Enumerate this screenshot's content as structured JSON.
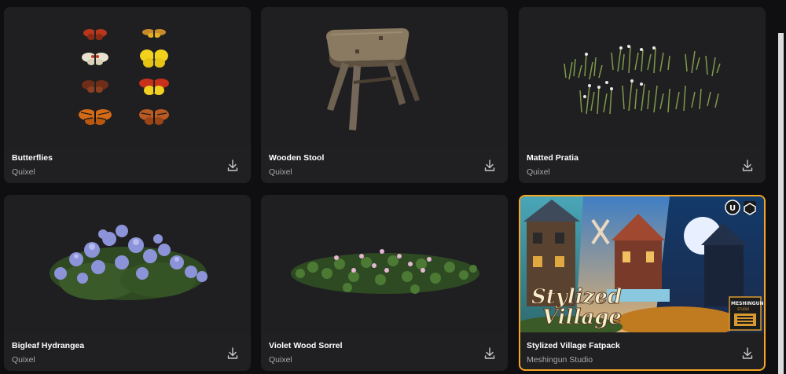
{
  "assets": [
    {
      "title": "Butterflies",
      "creator": "Quixel",
      "thumbnail": "butterflies-thumbnail"
    },
    {
      "title": "Wooden Stool",
      "creator": "Quixel",
      "thumbnail": "wooden-stool-thumbnail"
    },
    {
      "title": "Matted Pratia",
      "creator": "Quixel",
      "thumbnail": "matted-pratia-thumbnail"
    },
    {
      "title": "Bigleaf Hydrangea",
      "creator": "Quixel",
      "thumbnail": "bigleaf-hydrangea-thumbnail"
    },
    {
      "title": "Violet Wood Sorrel",
      "creator": "Quixel",
      "thumbnail": "violet-wood-sorrel-thumbnail"
    },
    {
      "title": "Stylized Village Fatpack",
      "creator": "Meshingun Studio",
      "thumbnail": "stylized-village-thumbnail",
      "thumb_title_line1": "Stylized",
      "thumb_title_line2": "Village",
      "brand_badge": "MESHINGUN",
      "brand_sub": "STUDIO"
    }
  ],
  "icons": {
    "download": "download-icon",
    "engine_a": "unreal-engine-icon",
    "engine_b": "unity-icon"
  },
  "colors": {
    "background": "#0f0f11",
    "card": "#202022",
    "highlight_border": "#f5a524",
    "creator_text": "#a8a8ad"
  }
}
